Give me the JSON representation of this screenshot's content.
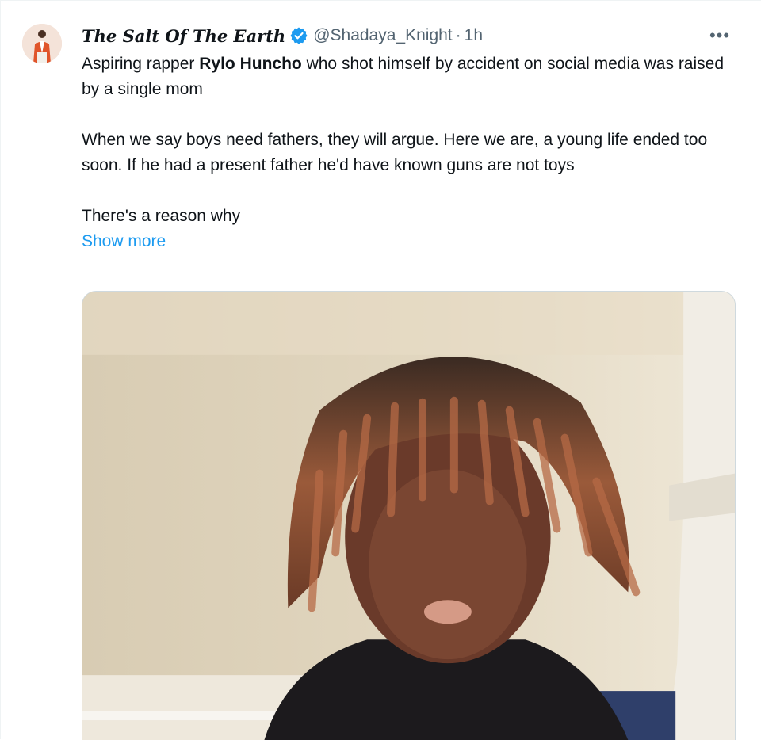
{
  "tweet": {
    "author": {
      "display_name": "The Salt Of The Earth",
      "verified_icon": "verified-badge-icon",
      "handle": "@Shadaya_Knight",
      "separator": "·",
      "time": "1h",
      "avatar_icon": "avatar-image"
    },
    "more_icon_label": "•••",
    "text": {
      "p1_before": "Aspiring rapper ",
      "p1_bold": "Rylo Huncho",
      "p1_after": " who shot himself by accident on social media was raised by a single mom",
      "p2": "When we say boys need fathers, they will argue. Here we are, a young life ended too soon. If he had a present father he'd have known guns are not toys",
      "p3": "There's a reason why",
      "show_more": "Show more"
    },
    "media": {
      "type": "photo",
      "description_icon": "photo-icon"
    }
  },
  "colors": {
    "text": "#0f1419",
    "secondary": "#536471",
    "link": "#1d9bf0",
    "verified": "#1d9bf0"
  }
}
